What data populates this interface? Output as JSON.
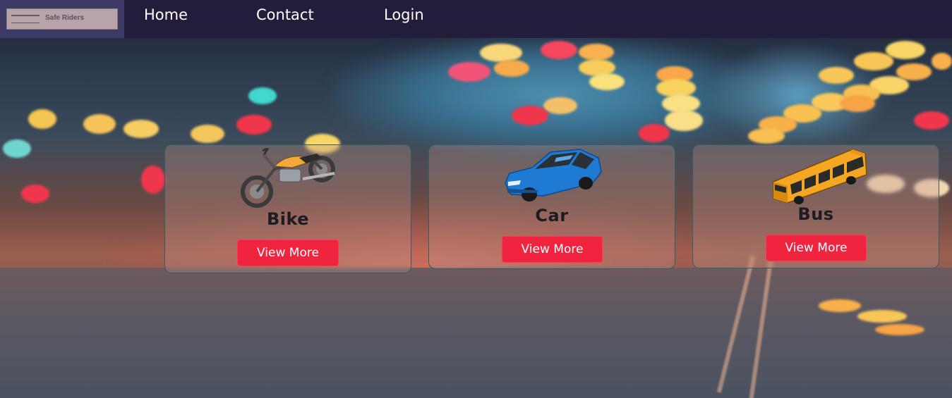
{
  "header": {
    "logo_text": "Safe Riders",
    "nav": [
      {
        "label": "Home"
      },
      {
        "label": "Contact"
      },
      {
        "label": "Login"
      }
    ]
  },
  "cards": [
    {
      "title": "Bike",
      "button": "View More",
      "icon": "motorcycle-icon"
    },
    {
      "title": "Car",
      "button": "View More",
      "icon": "car-icon"
    },
    {
      "title": "Bus",
      "button": "View More",
      "icon": "bus-icon"
    }
  ],
  "colors": {
    "navbar": "#231c3c",
    "button": "#f0243e",
    "card_border": "#2d5f6b"
  }
}
